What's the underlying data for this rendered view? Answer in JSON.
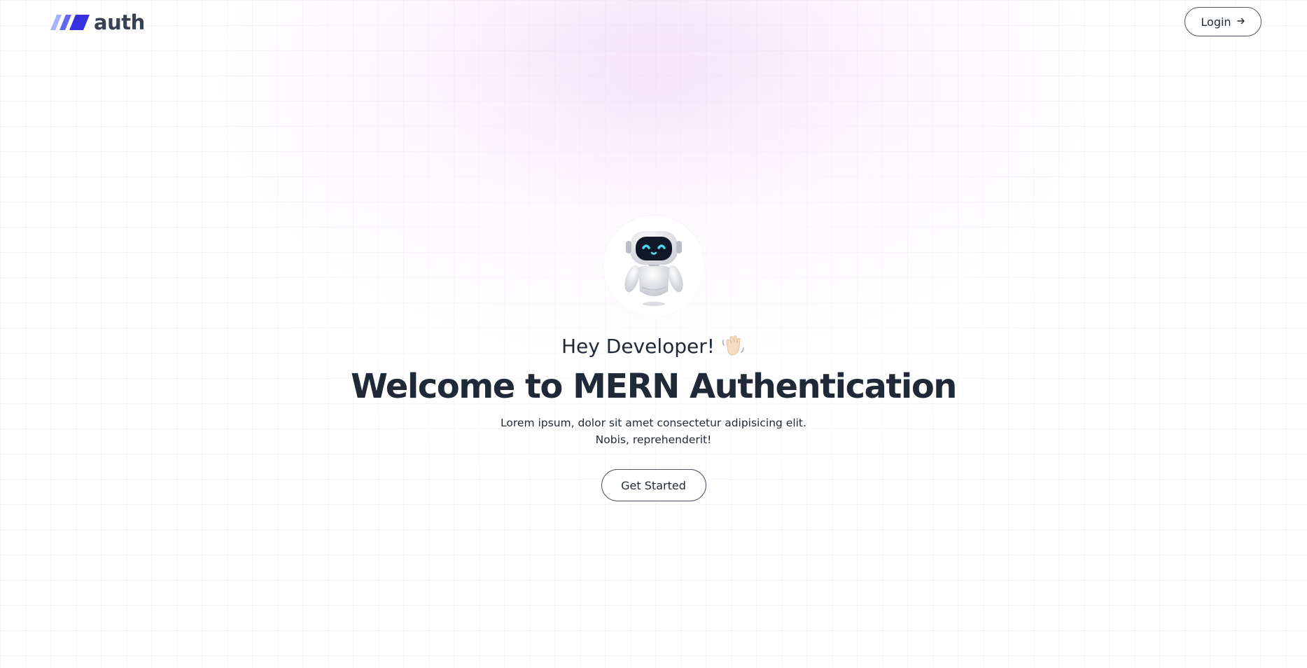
{
  "header": {
    "logo_text": "auth",
    "login_label": "Login",
    "login_icon": "arrow-right-icon"
  },
  "hero": {
    "avatar_icon": "robot-icon",
    "greeting": "Hey Developer!",
    "greeting_icon": "waving-hand-icon",
    "title": "Welcome to MERN Authentication",
    "description": "Lorem ipsum, dolor sit amet consectetur adipisicing elit. Nobis, reprehenderit!",
    "cta_label": "Get Started"
  },
  "colors": {
    "logo_accent": "#4f46e5",
    "logo_accent_light": "#818cf8",
    "text_primary": "#1f2937",
    "glow": "#f3d6fa"
  }
}
